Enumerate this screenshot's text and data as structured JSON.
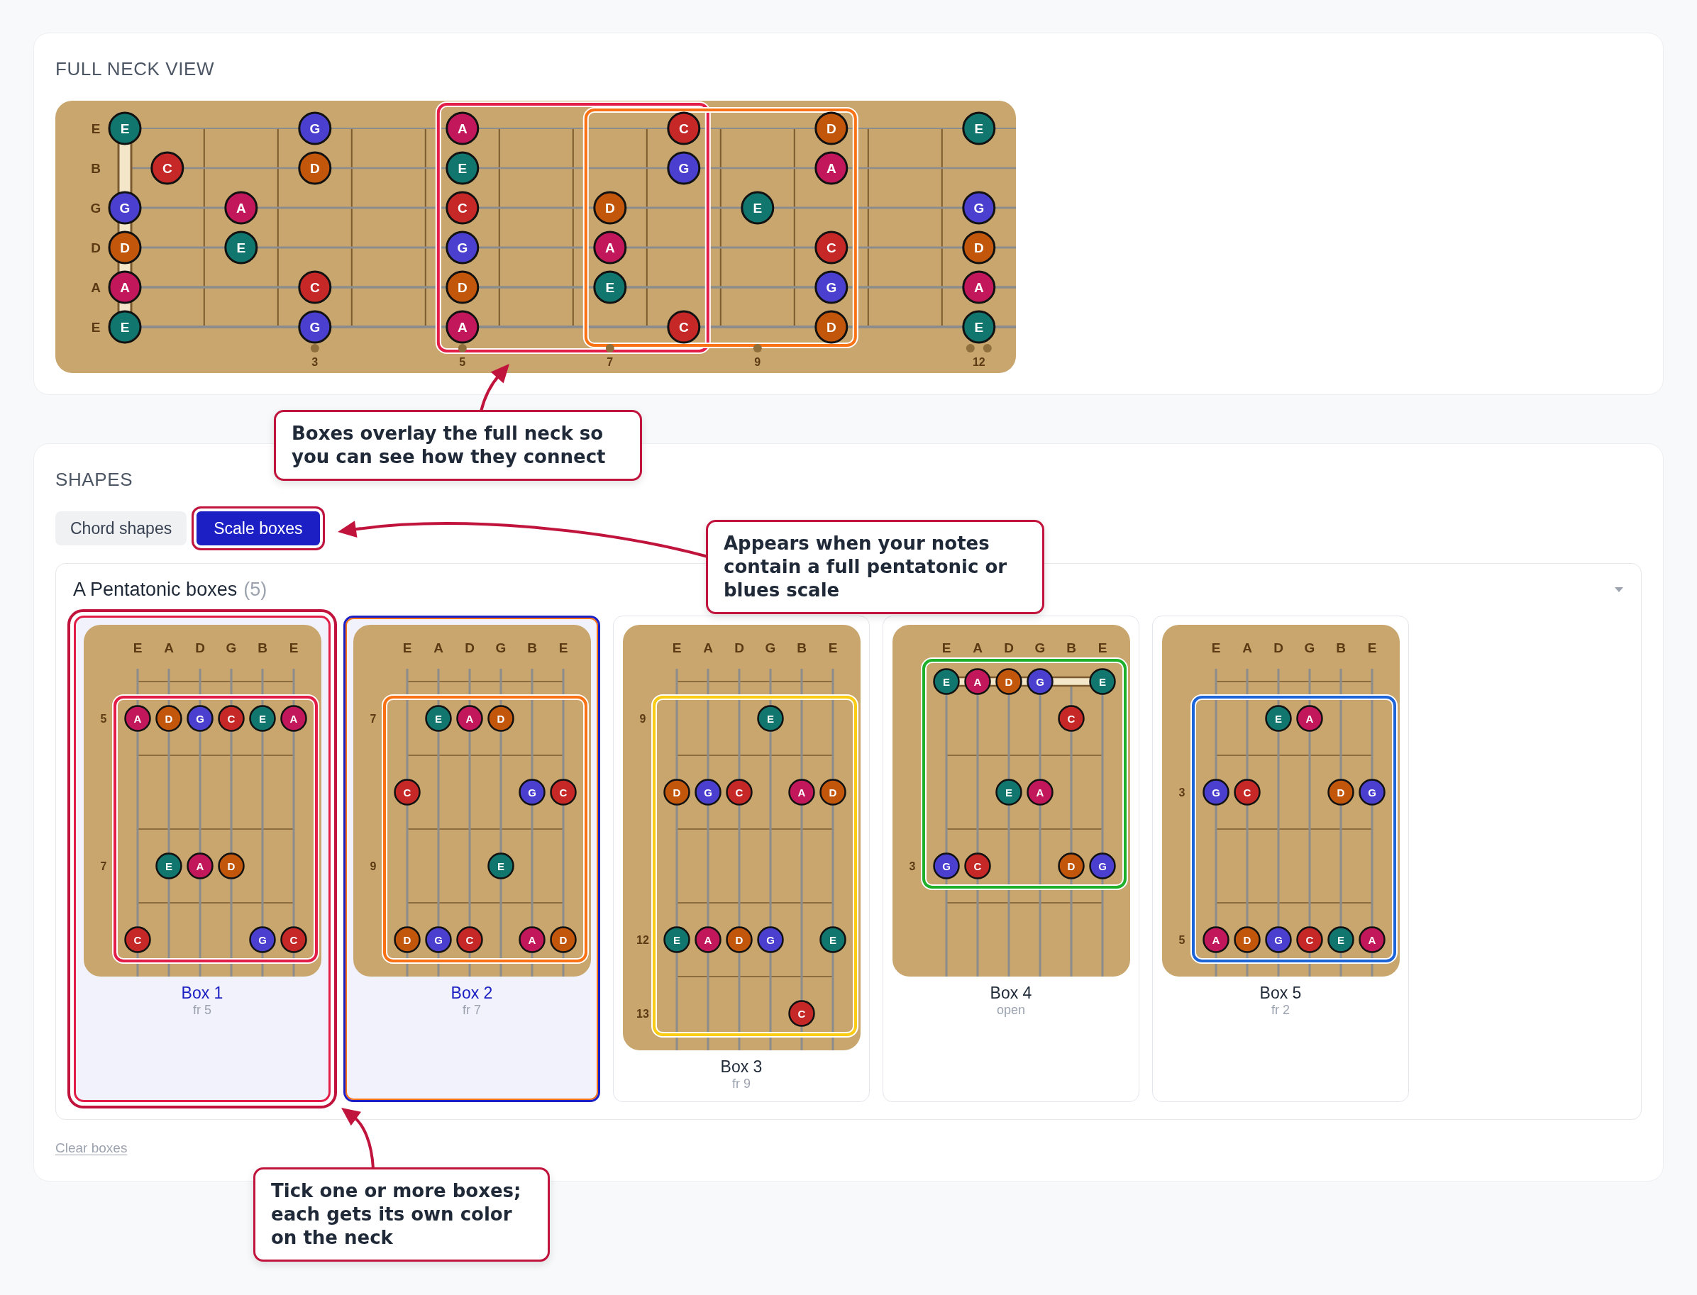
{
  "full_neck": {
    "title": "FULL NECK VIEW",
    "strings": [
      {
        "label": "E",
        "notes": [
          {
            "label": "E",
            "color": "#11766e"
          },
          {
            "label": "G",
            "color": "#4a3fcf"
          },
          {
            "label": "A",
            "color": "#c2185b"
          },
          {
            "label": "C",
            "color": "#c62828"
          },
          {
            "label": "D",
            "color": "#c2570c"
          },
          {
            "label": "E",
            "color": "#11766e"
          }
        ]
      },
      {
        "label": "B",
        "notes": [
          {
            "label": "C",
            "color": "#c62828"
          },
          {
            "label": "D",
            "color": "#c2570c"
          },
          {
            "label": "E",
            "color": "#11766e"
          },
          {
            "label": "G",
            "color": "#4a3fcf"
          },
          {
            "label": "A",
            "color": "#c2185b"
          }
        ]
      },
      {
        "label": "G",
        "notes": [
          {
            "label": "G",
            "color": "#4a3fcf"
          },
          {
            "label": "A",
            "color": "#c2185b"
          },
          {
            "label": "C",
            "color": "#c62828"
          },
          {
            "label": "D",
            "color": "#c2570c"
          },
          {
            "label": "E",
            "color": "#11766e"
          },
          {
            "label": "G",
            "color": "#4a3fcf"
          }
        ]
      },
      {
        "label": "D",
        "notes": [
          {
            "label": "D",
            "color": "#c2570c"
          },
          {
            "label": "E",
            "color": "#11766e"
          },
          {
            "label": "G",
            "color": "#4a3fcf"
          },
          {
            "label": "A",
            "color": "#c2185b"
          },
          {
            "label": "C",
            "color": "#c62828"
          },
          {
            "label": "D",
            "color": "#c2570c"
          }
        ]
      },
      {
        "label": "A",
        "notes": [
          {
            "label": "A",
            "color": "#c2185b"
          },
          {
            "label": "C",
            "color": "#c62828"
          },
          {
            "label": "D",
            "color": "#c2570c"
          },
          {
            "label": "E",
            "color": "#11766e"
          },
          {
            "label": "G",
            "color": "#4a3fcf"
          },
          {
            "label": "A",
            "color": "#c2185b"
          }
        ]
      },
      {
        "label": "E",
        "notes": [
          {
            "label": "E",
            "color": "#11766e"
          },
          {
            "label": "G",
            "color": "#4a3fcf"
          },
          {
            "label": "A",
            "color": "#c2185b"
          },
          {
            "label": "C",
            "color": "#c62828"
          },
          {
            "label": "D",
            "color": "#c2570c"
          },
          {
            "label": "E",
            "color": "#11766e"
          }
        ]
      }
    ],
    "fret_numbers": [
      "3",
      "5",
      "7",
      "9",
      "12"
    ],
    "box_overlays": [
      {
        "color": "#e11d48"
      },
      {
        "color": "#f97316"
      }
    ]
  },
  "shapes": {
    "title": "SHAPES",
    "tabs": [
      {
        "label": "Chord shapes",
        "selected": false,
        "highlighted": false
      },
      {
        "label": "Scale boxes",
        "selected": true,
        "highlighted": true
      }
    ],
    "panel": {
      "title": "A Pentatonic boxes",
      "count": "(5)",
      "expanded": true,
      "boxes": [
        {
          "title": "Box 1",
          "subtitle": "fr 5",
          "selected": true,
          "highlighted": true,
          "color": "#e11d48",
          "strings": [
            "E",
            "A",
            "D",
            "G",
            "B",
            "E"
          ],
          "rows": [
            {
              "kind": "fret",
              "label": "5",
              "notes": [
                {
                  "label": "A",
                  "color": "#c2185b"
                },
                {
                  "label": "D",
                  "color": "#c2570c"
                },
                {
                  "label": "G",
                  "color": "#4a3fcf"
                },
                {
                  "label": "C",
                  "color": "#c62828"
                },
                {
                  "label": "E",
                  "color": "#11766e"
                },
                {
                  "label": "A",
                  "color": "#c2185b"
                }
              ]
            },
            {
              "kind": "fret"
            },
            {
              "kind": "fret",
              "label": "7",
              "notes": [
                {
                  "label": "E",
                  "color": "#11766e"
                },
                {
                  "label": "A",
                  "color": "#c2185b"
                },
                {
                  "label": "D",
                  "color": "#c2570c"
                }
              ]
            },
            {
              "kind": "fret",
              "notes": [
                {
                  "label": "C",
                  "color": "#c62828"
                },
                {
                  "label": "G",
                  "color": "#4a3fcf"
                },
                {
                  "label": "C",
                  "color": "#c62828"
                }
              ]
            }
          ]
        },
        {
          "title": "Box 2",
          "subtitle": "fr 7",
          "selected": true,
          "highlighted": false,
          "color": "#f97316",
          "strings": [
            "E",
            "A",
            "D",
            "G",
            "B",
            "E"
          ],
          "rows": [
            {
              "kind": "fret",
              "label": "7",
              "notes": [
                {
                  "label": "E",
                  "color": "#11766e"
                },
                {
                  "label": "A",
                  "color": "#c2185b"
                },
                {
                  "label": "D",
                  "color": "#c2570c"
                }
              ]
            },
            {
              "kind": "fret",
              "notes": [
                {
                  "label": "C",
                  "color": "#c62828"
                },
                {
                  "label": "G",
                  "color": "#4a3fcf"
                },
                {
                  "label": "C",
                  "color": "#c62828"
                }
              ]
            },
            {
              "kind": "fret",
              "label": "9",
              "notes": [
                {
                  "label": "E",
                  "color": "#11766e"
                }
              ]
            },
            {
              "kind": "fret",
              "notes": [
                {
                  "label": "D",
                  "color": "#c2570c"
                },
                {
                  "label": "G",
                  "color": "#4a3fcf"
                },
                {
                  "label": "C",
                  "color": "#c62828"
                },
                {
                  "label": "A",
                  "color": "#c2185b"
                },
                {
                  "label": "D",
                  "color": "#c2570c"
                }
              ]
            }
          ]
        },
        {
          "title": "Box 3",
          "subtitle": "fr 9",
          "selected": false,
          "highlighted": false,
          "color": "#facc15",
          "strings": [
            "E",
            "A",
            "D",
            "G",
            "B",
            "E"
          ],
          "rows": [
            {
              "kind": "fret",
              "label": "9",
              "notes": [
                {
                  "label": "E",
                  "color": "#11766e"
                }
              ]
            },
            {
              "kind": "fret",
              "notes": [
                {
                  "label": "D",
                  "color": "#c2570c"
                },
                {
                  "label": "G",
                  "color": "#4a3fcf"
                },
                {
                  "label": "C",
                  "color": "#c62828"
                },
                {
                  "label": "A",
                  "color": "#c2185b"
                },
                {
                  "label": "D",
                  "color": "#c2570c"
                }
              ]
            },
            {
              "kind": "fret"
            },
            {
              "kind": "fret",
              "label": "12",
              "notes": [
                {
                  "label": "E",
                  "color": "#11766e"
                },
                {
                  "label": "A",
                  "color": "#c2185b"
                },
                {
                  "label": "D",
                  "color": "#c2570c"
                },
                {
                  "label": "G",
                  "color": "#4a3fcf"
                },
                {
                  "label": "E",
                  "color": "#11766e"
                }
              ]
            },
            {
              "kind": "fret",
              "label": "13",
              "notes": [
                {
                  "label": "C",
                  "color": "#c62828"
                }
              ]
            }
          ]
        },
        {
          "title": "Box 4",
          "subtitle": "open",
          "selected": false,
          "highlighted": false,
          "color": "#1fb02b",
          "strings": [
            "E",
            "A",
            "D",
            "G",
            "B",
            "E"
          ],
          "rows": [
            {
              "kind": "open",
              "notes": [
                {
                  "label": "E",
                  "color": "#11766e"
                },
                {
                  "label": "A",
                  "color": "#c2185b"
                },
                {
                  "label": "D",
                  "color": "#c2570c"
                },
                {
                  "label": "G",
                  "color": "#4a3fcf"
                },
                {
                  "label": "E",
                  "color": "#11766e"
                }
              ]
            },
            {
              "kind": "fret",
              "notes": [
                {
                  "label": "C",
                  "color": "#c62828"
                }
              ]
            },
            {
              "kind": "fret",
              "notes": [
                {
                  "label": "E",
                  "color": "#11766e"
                },
                {
                  "label": "A",
                  "color": "#c2185b"
                }
              ]
            },
            {
              "kind": "fret",
              "label": "3",
              "notes": [
                {
                  "label": "G",
                  "color": "#4a3fcf"
                },
                {
                  "label": "C",
                  "color": "#c62828"
                },
                {
                  "label": "D",
                  "color": "#c2570c"
                },
                {
                  "label": "G",
                  "color": "#4a3fcf"
                }
              ]
            },
            {
              "kind": "fret"
            }
          ]
        },
        {
          "title": "Box 5",
          "subtitle": "fr 2",
          "selected": false,
          "highlighted": false,
          "color": "#1d64d8",
          "strings": [
            "E",
            "A",
            "D",
            "G",
            "B",
            "E"
          ],
          "rows": [
            {
              "kind": "fret",
              "notes": [
                {
                  "label": "E",
                  "color": "#11766e"
                },
                {
                  "label": "A",
                  "color": "#c2185b"
                }
              ]
            },
            {
              "kind": "fret",
              "label": "3",
              "notes": [
                {
                  "label": "G",
                  "color": "#4a3fcf"
                },
                {
                  "label": "C",
                  "color": "#c62828"
                },
                {
                  "label": "D",
                  "color": "#c2570c"
                },
                {
                  "label": "G",
                  "color": "#4a3fcf"
                }
              ]
            },
            {
              "kind": "fret"
            },
            {
              "kind": "fret",
              "label": "5",
              "notes": [
                {
                  "label": "A",
                  "color": "#c2185b"
                },
                {
                  "label": "D",
                  "color": "#c2570c"
                },
                {
                  "label": "G",
                  "color": "#4a3fcf"
                },
                {
                  "label": "C",
                  "color": "#c62828"
                },
                {
                  "label": "E",
                  "color": "#11766e"
                },
                {
                  "label": "A",
                  "color": "#c2185b"
                }
              ]
            }
          ]
        }
      ]
    },
    "clear_link": "Clear boxes"
  },
  "callouts": [
    {
      "text": "Boxes overlay the full neck so you can see how they connect"
    },
    {
      "text": "Appears when your notes contain a full pentatonic or blues scale"
    },
    {
      "text": "Tick one or more boxes; each gets its own color on the neck"
    }
  ]
}
